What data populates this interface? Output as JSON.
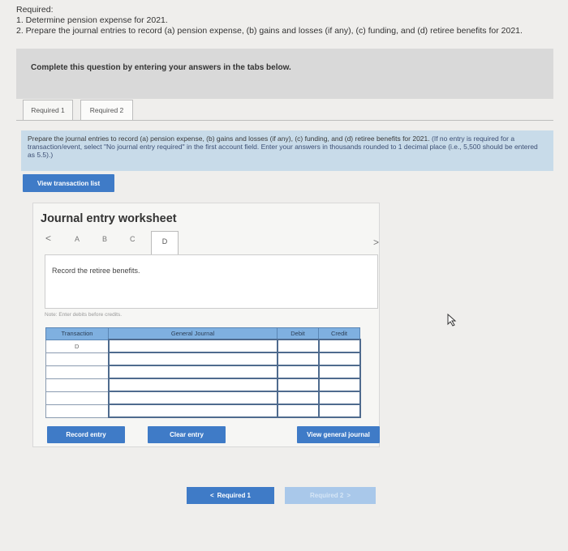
{
  "header": {
    "required_label": "Required:",
    "line1": "1. Determine pension expense for 2021.",
    "line2": "2. Prepare the journal entries to record (a) pension expense, (b) gains and losses (if any), (c) funding, and (d) retiree benefits for 2021."
  },
  "banner": {
    "text": "Complete this question by entering your answers in the tabs below."
  },
  "tabs": [
    {
      "label": "Required 1"
    },
    {
      "label": "Required 2"
    }
  ],
  "instructions": {
    "main": "Prepare the journal entries to record (a) pension expense, (b) gains and losses (if any), (c) funding, and (d) retiree benefits for 2021.",
    "rest": "(If no entry is required for a transaction/event, select \"No journal entry required\" in the first account field. Enter your answers in thousands rounded to 1 decimal place (i.e., 5,500 should be entered as 5.5).)"
  },
  "view_transaction_list": "View transaction list",
  "worksheet": {
    "title": "Journal entry worksheet",
    "nav": {
      "prev": "<",
      "next": ">",
      "items": [
        "A",
        "B",
        "C",
        "D"
      ]
    },
    "record_text": "Record the retiree benefits.",
    "note": "Note: Enter debits before credits.",
    "table": {
      "headers": [
        "Transaction",
        "General Journal",
        "Debit",
        "Credit"
      ],
      "first_transaction": "D"
    },
    "record_entry": "Record entry",
    "clear_entry": "Clear entry",
    "view_general_journal": "View general journal"
  },
  "pager": {
    "prev_icon": "<",
    "prev": "Required 1",
    "next": "Required 2",
    "next_icon": ">"
  },
  "colors": {
    "button_blue": "#3f7bc7",
    "header_blue": "#7fb0e0",
    "instruction_bg": "#c8dbe9"
  }
}
